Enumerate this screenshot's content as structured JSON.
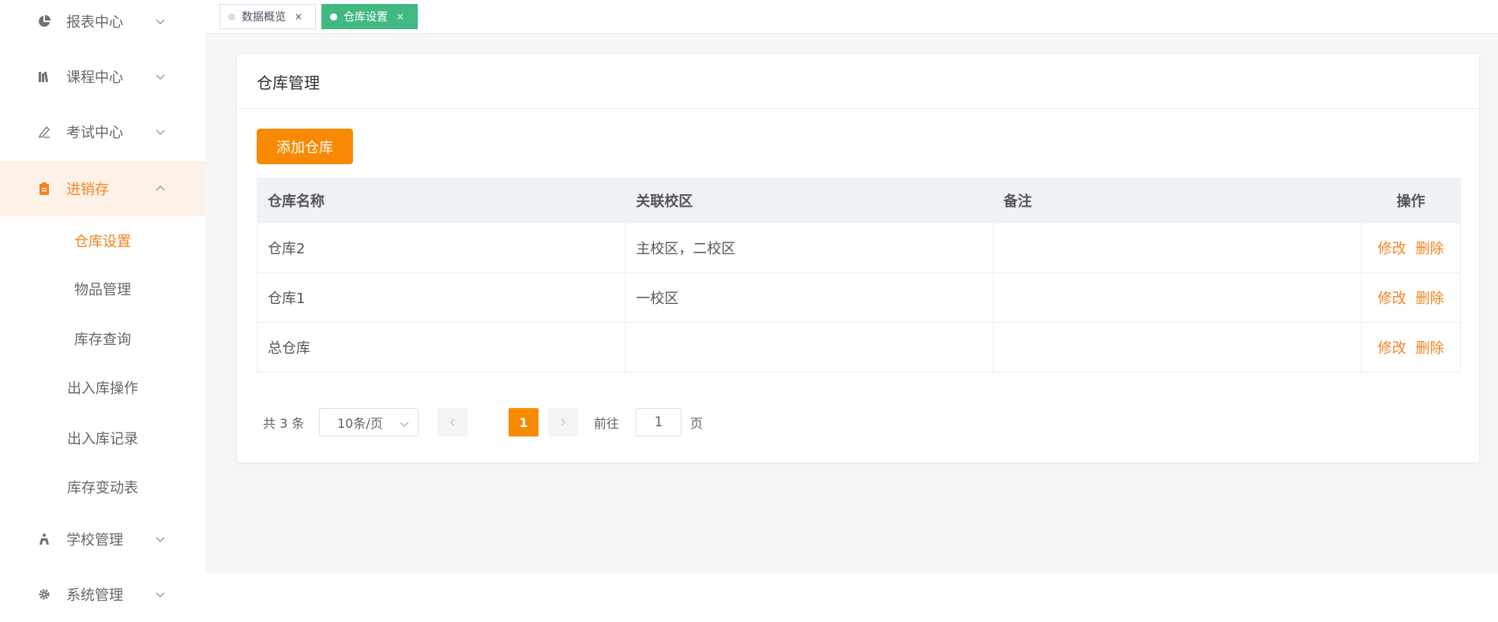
{
  "sidebar": {
    "menus": [
      {
        "label": "报表中心",
        "icon": "pie-chart-icon",
        "expanded": false
      },
      {
        "label": "课程中心",
        "icon": "books-icon",
        "expanded": false
      },
      {
        "label": "考试中心",
        "icon": "pen-icon",
        "expanded": false
      },
      {
        "label": "进销存",
        "icon": "clipboard-icon",
        "expanded": true
      },
      {
        "label": "学校管理",
        "icon": "school-icon",
        "expanded": false
      },
      {
        "label": "系统管理",
        "icon": "gear-icon",
        "expanded": false
      }
    ],
    "submenu": [
      {
        "label": "仓库设置",
        "active": true
      },
      {
        "label": "物品管理",
        "active": false
      },
      {
        "label": "库存查询",
        "active": false
      },
      {
        "label": "出入库操作",
        "active": false
      },
      {
        "label": "出入库记录",
        "active": false
      },
      {
        "label": "库存变动表",
        "active": false
      }
    ]
  },
  "tabs": [
    {
      "label": "数据概览",
      "close": "×",
      "active": false
    },
    {
      "label": "仓库设置",
      "close": "×",
      "active": true
    }
  ],
  "card": {
    "title": "仓库管理",
    "add_button": "添加仓库"
  },
  "table": {
    "columns": [
      "仓库名称",
      "关联校区",
      "备注",
      "操作"
    ],
    "rows": [
      {
        "name": "仓库2",
        "campus": "主校区，二校区",
        "note": ""
      },
      {
        "name": "仓库1",
        "campus": "一校区",
        "note": ""
      },
      {
        "name": "总仓库",
        "campus": "",
        "note": ""
      }
    ],
    "actions": {
      "edit": "修改",
      "delete": "删除"
    }
  },
  "pagination": {
    "total": "共 3 条",
    "page_size": "10条/页",
    "current_page": "1",
    "goto_label": "前往",
    "goto_value": "1",
    "goto_suffix": "页"
  },
  "colors": {
    "accent": "#f88a03",
    "active_tab": "#42b983",
    "active_menu_bg": "#fdf1e8"
  }
}
